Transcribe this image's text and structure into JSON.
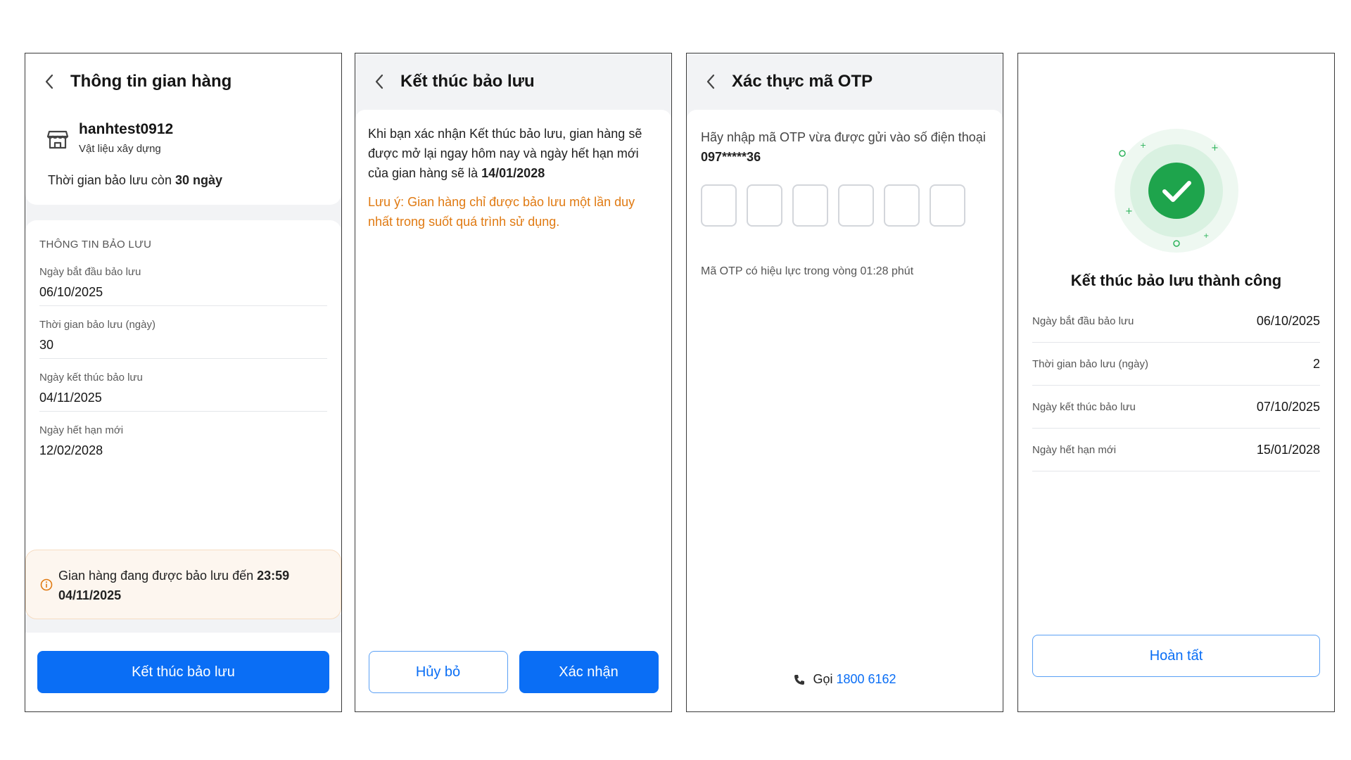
{
  "screen1": {
    "title": "Thông tin gian hàng",
    "store_name": "hanhtest0912",
    "store_category": "Vật liệu xây dựng",
    "remaining_prefix": "Thời gian bảo lưu còn ",
    "remaining_value": "30 ngày",
    "section_title": "THÔNG TIN BẢO LƯU",
    "fields": [
      {
        "label": "Ngày bắt đầu bảo lưu",
        "value": "06/10/2025"
      },
      {
        "label": "Thời gian bảo lưu (ngày)",
        "value": "30"
      },
      {
        "label": "Ngày kết thúc bảo lưu",
        "value": "04/11/2025"
      },
      {
        "label": "Ngày hết hạn mới",
        "value": "12/02/2028"
      }
    ],
    "notice_text": "Gian hàng đang được bảo lưu đến ",
    "notice_time": "23:59",
    "notice_date": "04/11/2025",
    "button_label": "Kết thúc bảo lưu"
  },
  "screen2": {
    "title": "Kết thúc bảo lưu",
    "body_text": "Khi bạn xác nhận Kết thúc bảo lưu, gian hàng sẽ được mở lại ngay hôm nay và ngày hết hạn mới của gian hàng sẽ là ",
    "body_date": "14/01/2028",
    "warning": "Lưu ý: Gian hàng chỉ được bảo lưu một lần duy nhất trong suốt quá trình sử dụng.",
    "cancel_label": "Hủy bỏ",
    "confirm_label": "Xác nhận"
  },
  "screen3": {
    "title": "Xác thực mã OTP",
    "prompt": "Hãy nhập mã OTP vừa được gửi vào số điện thoại ",
    "phone_masked": "097*****36",
    "otp_digits": [
      "",
      "",
      "",
      "",
      "",
      ""
    ],
    "validity_text": "Mã OTP có hiệu lực trong vòng 01:28 phút",
    "call_label": "Gọi",
    "call_number": "1800 6162"
  },
  "screen4": {
    "title": "Kết thúc bảo lưu thành công",
    "rows": [
      {
        "label": "Ngày bắt đầu bảo lưu",
        "value": "06/10/2025"
      },
      {
        "label": "Thời gian bảo lưu (ngày)",
        "value": "2"
      },
      {
        "label": "Ngày kết thúc bảo lưu",
        "value": "07/10/2025"
      },
      {
        "label": "Ngày hết hạn mới",
        "value": "15/01/2028"
      }
    ],
    "done_label": "Hoàn tất"
  },
  "icons": {
    "back": "chevron-left-icon",
    "store": "store-icon",
    "info": "info-icon",
    "phone": "phone-icon",
    "success": "checkmark-icon"
  },
  "colors": {
    "primary": "#0a6ef5",
    "warning_text": "#e07a12",
    "notice_bg": "#fdf6ef",
    "success": "#1ea44c"
  }
}
